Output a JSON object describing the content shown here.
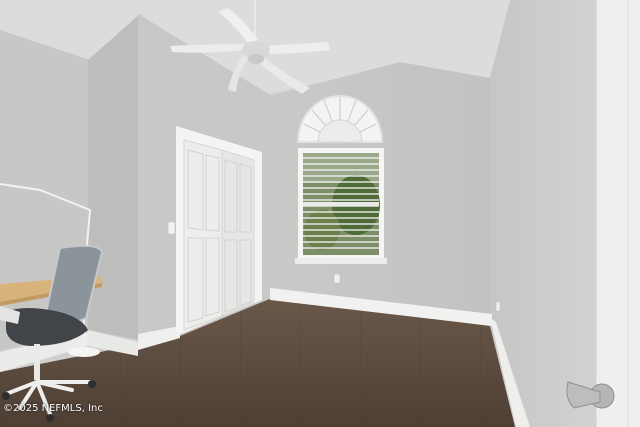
{
  "photo": {
    "watermark": "©2025 NEFMLS, Inc",
    "colors": {
      "wall": "#c4c5c4",
      "wall_light": "#d3d3d2",
      "ceiling": "#dcdcdb",
      "floor": "#5e4d40",
      "trim": "#f3f3f1",
      "door": "#ededeb",
      "window_green": "#5f7a45"
    }
  }
}
